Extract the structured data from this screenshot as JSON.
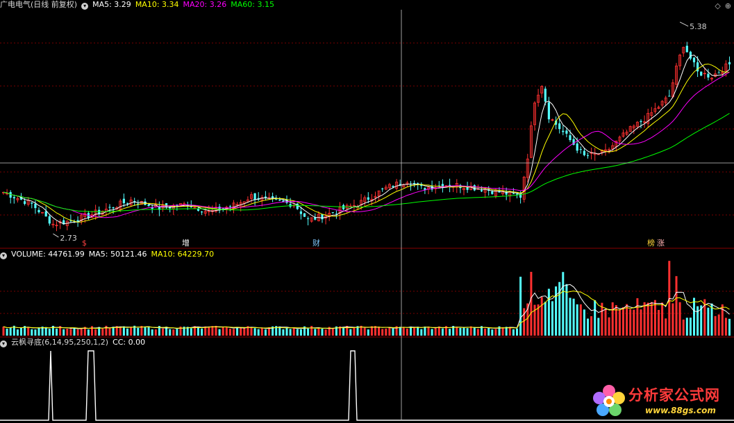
{
  "price_legend": {
    "stock": "广电电气(日线 前复权)",
    "ma5": "MA5: 3.29",
    "ma10": "MA10: 3.34",
    "ma20": "MA20: 3.26",
    "ma60": "MA60: 3.15"
  },
  "volume_legend": {
    "volume": "VOLUME: 44761.99",
    "ma5": "MA5: 50121.46",
    "ma10": "MA10: 64229.70"
  },
  "indicator_legend": {
    "name": "云枫寻底(6,14,95,250,1,2)",
    "cc": "CC: 0.00"
  },
  "price_high_label": "5.38",
  "price_low_label": "2.73",
  "event_markers": [
    "$",
    "增",
    "财",
    "榜",
    "涨"
  ],
  "colors": {
    "up": "#ff3030",
    "down": "#54ffff",
    "ma5": "#ffffff",
    "ma10": "#ffff00",
    "ma20": "#ff00ff",
    "ma60": "#00ff00",
    "grid": "#7a0000",
    "crosshair": "#c8c8c8"
  },
  "watermark": {
    "title": "分析家公式网",
    "url": "www.88gs.com"
  },
  "chart_data": [
    {
      "type": "candlestick",
      "title": "广电电气(日线 前复权)",
      "series": [
        {
          "name": "MA5",
          "last": 3.29
        },
        {
          "name": "MA10",
          "last": 3.34
        },
        {
          "name": "MA20",
          "last": 3.26
        },
        {
          "name": "MA60",
          "last": 3.15
        }
      ],
      "annotations": [
        {
          "label": "5.38",
          "meaning": "period high"
        },
        {
          "label": "2.73",
          "meaning": "period low"
        }
      ],
      "ylim": [
        2.6,
        5.5
      ],
      "grid": true
    },
    {
      "type": "bar",
      "title": "VOLUME",
      "series": [
        {
          "name": "VOLUME",
          "last": 44761.99
        },
        {
          "name": "MA5",
          "last": 50121.46
        },
        {
          "name": "MA10",
          "last": 64229.7
        }
      ]
    },
    {
      "type": "line",
      "title": "云枫寻底(6,14,95,250,1,2)",
      "series": [
        {
          "name": "CC",
          "last": 0.0
        }
      ],
      "ylim": [
        0,
        1
      ]
    }
  ]
}
